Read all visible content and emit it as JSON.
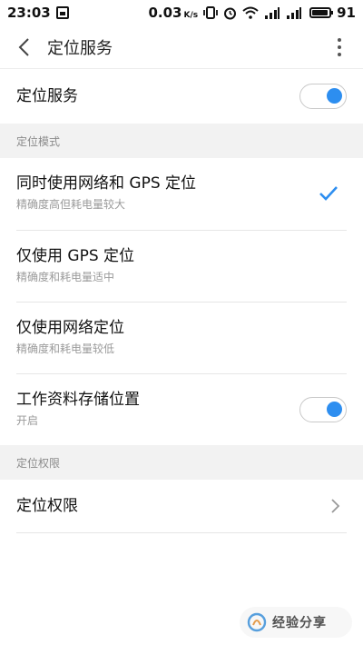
{
  "status_bar": {
    "time": "23:03",
    "net_speed": "0.03",
    "net_speed_unit": "K/s",
    "battery": "91",
    "icons": [
      "notification-icon",
      "vibrate-icon",
      "alarm-icon",
      "wifi-icon",
      "signal-3g-icon",
      "signal-icon",
      "battery-icon"
    ]
  },
  "header": {
    "title": "定位服务"
  },
  "location_service": {
    "label": "定位服务",
    "enabled": true
  },
  "section_mode": {
    "label": "定位模式"
  },
  "modes": [
    {
      "title": "同时使用网络和 GPS 定位",
      "subtitle": "精确度高但耗电量较大",
      "selected": true
    },
    {
      "title": "仅使用 GPS 定位",
      "subtitle": "精确度和耗电量适中",
      "selected": false
    },
    {
      "title": "仅使用网络定位",
      "subtitle": "精确度和耗电量较低",
      "selected": false
    }
  ],
  "work_profile": {
    "title": "工作资料存储位置",
    "subtitle": "开启",
    "enabled": true
  },
  "section_permission": {
    "label": "定位权限"
  },
  "permission": {
    "label": "定位权限"
  },
  "watermark": {
    "text": "经验分享"
  },
  "colors": {
    "accent": "#2d8ef0",
    "section_bg": "#f2f2f2",
    "subtext": "#9a9a9a"
  }
}
